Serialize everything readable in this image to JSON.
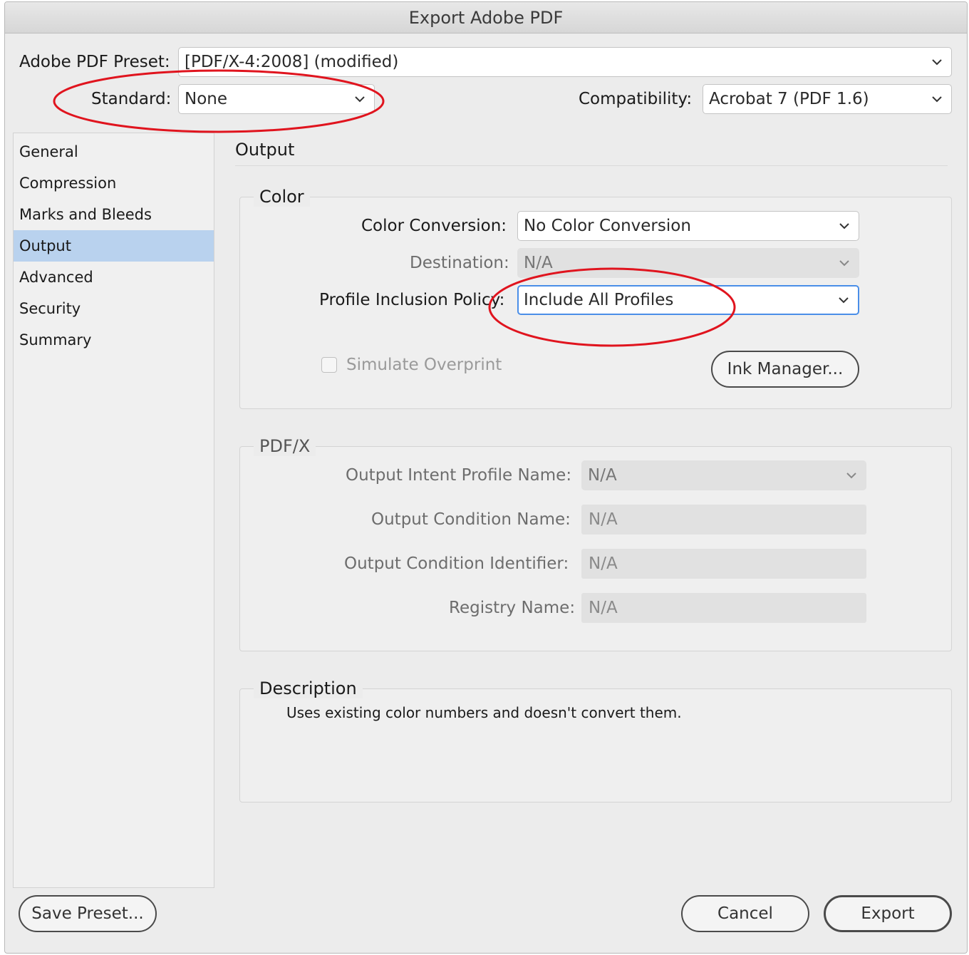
{
  "window": {
    "title": "Export Adobe PDF"
  },
  "preset": {
    "label": "Adobe PDF Preset:",
    "value": "[PDF/X-4:2008] (modified)"
  },
  "standard": {
    "label": "Standard:",
    "value": "None"
  },
  "compatibility": {
    "label": "Compatibility:",
    "value": "Acrobat 7 (PDF 1.6)"
  },
  "sidebar": {
    "items": [
      {
        "label": "General"
      },
      {
        "label": "Compression"
      },
      {
        "label": "Marks and Bleeds"
      },
      {
        "label": "Output"
      },
      {
        "label": "Advanced"
      },
      {
        "label": "Security"
      },
      {
        "label": "Summary"
      }
    ],
    "selected": "Output"
  },
  "main": {
    "section_title": "Output",
    "color": {
      "title": "Color",
      "conversion_label": "Color Conversion:",
      "conversion_value": "No Color Conversion",
      "destination_label": "Destination:",
      "destination_value": "N/A",
      "profile_label": "Profile Inclusion Policy:",
      "profile_value": "Include All Profiles",
      "simulate_label": "Simulate Overprint",
      "ink_manager_label": "Ink Manager..."
    },
    "pdfx": {
      "title": "PDF/X",
      "intent_label": "Output Intent Profile Name:",
      "intent_value": "N/A",
      "condition_name_label": "Output Condition Name:",
      "condition_name_value": "N/A",
      "condition_id_label": "Output Condition Identifier:",
      "condition_id_value": "N/A",
      "registry_label": "Registry Name:",
      "registry_value": "N/A"
    },
    "description": {
      "title": "Description",
      "text": "Uses existing color numbers and doesn't convert them."
    }
  },
  "footer": {
    "save_preset": "Save Preset...",
    "cancel": "Cancel",
    "export": "Export"
  },
  "colors": {
    "accent": "#4a8ee8",
    "selection": "#b9d2ee",
    "annotation": "#e0141e"
  },
  "icons": [
    "chevron-down-icon",
    "checkbox-unchecked-icon"
  ]
}
